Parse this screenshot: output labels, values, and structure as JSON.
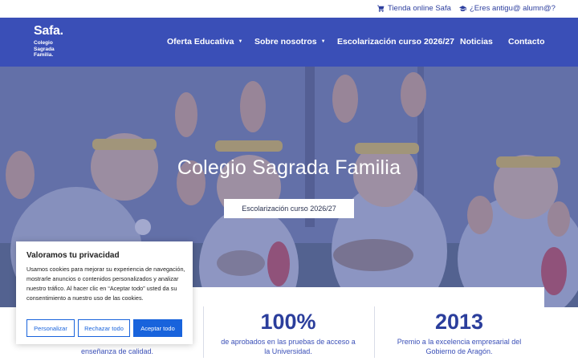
{
  "topbar": {
    "shop_label": "Tienda online Safa",
    "shop_icon": "cart-icon",
    "alumni_label": "¿Eres antigu@ alumn@?",
    "alumni_icon": "graduation-cap-icon"
  },
  "logo": {
    "mark": "Safa.",
    "line1": "Colegio",
    "line2": "Sagrada",
    "line3": "Familia."
  },
  "nav": {
    "items": [
      {
        "label": "Oferta Educativa",
        "has_dropdown": true
      },
      {
        "label": "Sobre nosotros",
        "has_dropdown": true
      },
      {
        "label": "Escolarización curso 2026/27",
        "has_dropdown": false
      },
      {
        "label": "Noticias",
        "has_dropdown": false
      },
      {
        "label": "Contacto",
        "has_dropdown": false
      }
    ],
    "caret": "▼"
  },
  "hero": {
    "title": "Colegio Sagrada Familia",
    "button_label": "Escolarización curso 2026/27"
  },
  "stats": [
    {
      "number": "",
      "desc_line1": "",
      "desc_line2": "enseñanza de calidad."
    },
    {
      "number": "100%",
      "desc_line1": "de aprobados en las pruebas de acceso a",
      "desc_line2": "la Universidad."
    },
    {
      "number": "2013",
      "desc_line1": "Premio a la excelencia empresarial del",
      "desc_line2": "Gobierno de Aragón."
    }
  ],
  "cookie": {
    "title": "Valoramos tu privacidad",
    "text": "Usamos cookies para mejorar su experiencia de navegación, mostrarle anuncios o contenidos personalizados y analizar nuestro tráfico. Al hacer clic en “Aceptar todo” usted da su consentimiento a nuestro uso de las cookies.",
    "customize_label": "Personalizar",
    "reject_label": "Rechazar todo",
    "accept_label": "Aceptar todo"
  },
  "colors": {
    "brand_blue": "#3a4fb7",
    "stat_blue": "#2b3e9c",
    "cookie_button_blue": "#1863dc"
  }
}
